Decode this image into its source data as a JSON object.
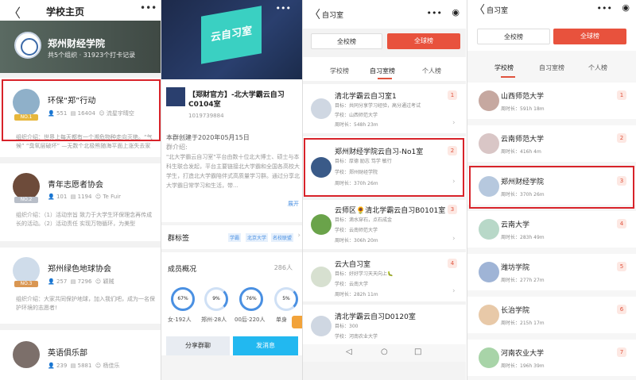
{
  "p1": {
    "back": "〈",
    "title": "学校主页",
    "dots": "•••",
    "school_name": "郑州财经学院",
    "school_sub": "共5个组织 · 31923个打卡记录",
    "cards": [
      {
        "name": "环保“郑”行动",
        "badge": "NO.1",
        "s1": "551",
        "s2": "16404",
        "s3": "流星宇晴空",
        "desc": "组织介绍：世界上每天都有一个濒危物种走向灭绝。“气候” “臭氧层破坏” —无数个北极熊随海平面上涨失去家"
      },
      {
        "name": "青年志愿者协会",
        "badge": "NO.2",
        "s1": "101",
        "s2": "1194",
        "s3": "Te Fuir",
        "desc": "组织介绍：（1）活动宗旨 致力于大学生环保理念再传成长的活动。（2）活动责任 实现万物循环，为美型"
      },
      {
        "name": "郑州绿色地球协会",
        "badge": "NO.3",
        "s1": "257",
        "s2": "7296",
        "s3": "颖贼",
        "desc": "组织介绍：大家共同保护地球，加入我们吧，成为一名保护环境的志愿者!"
      },
      {
        "name": "英语俱乐部",
        "badge": "",
        "s1": "239",
        "s2": "5881",
        "s3": "杨佳乐",
        "desc": ""
      }
    ]
  },
  "p2": {
    "dots": "•••",
    "cloud": "云自习室",
    "group_title": "【郑财官方】-北大学霸云自习C0104室",
    "group_id": "1019739884",
    "create_date": "本群创建于2020年05月15日",
    "intro_label": "群介绍:",
    "intro": "\"北大学霸云自习室\"平台由数十位北大博士、硕士与本科生联合发起，平台主要链接北大学霸和全国各高校大学生，打造北大学霸陪伴式高质量学习群。通过分享北大学霸日常学习和生活，带...",
    "expand": "展开",
    "tags_label": "群标签",
    "tags": [
      "学霸",
      "北京大学",
      "名校联盟"
    ],
    "members_label": "成员概况",
    "members_count": "286人",
    "rings": [
      {
        "pct": "67%",
        "label": "女·192人"
      },
      {
        "pct": "9%",
        "label": "郑州·28人"
      },
      {
        "pct": "76%",
        "label": "00后·220人"
      },
      {
        "pct": "5%",
        "label": "单身"
      }
    ],
    "share_btn": "分享群聊",
    "send_btn": "发消息"
  },
  "p3": {
    "back": "〈",
    "title": "自习室",
    "dots": "•••",
    "target": "◉",
    "btn_school": "全校榜",
    "btn_global": "全球榜",
    "tabs": [
      "学校榜",
      "自习室榜",
      "个人榜"
    ],
    "rows": [
      {
        "name": "清北学霸云自习室1",
        "goal": "目标：共同分享学习经验，高分通过考试",
        "school": "学校：山西师范大学",
        "time": "周时长：548h 23m",
        "rank": "1"
      },
      {
        "name": "郑州财经学院云自习-No1室",
        "goal": "目标：厚德 励志 笃学 敏行",
        "school": "学校：郑州财经学院",
        "time": "周时长：370h 26m",
        "rank": "2"
      },
      {
        "name": "云师区🌻清北学霸云自习B0101室",
        "goal": "目标：滴水穿石，点石成金",
        "school": "学校：云南师范大学",
        "time": "周时长：306h 20m",
        "rank": "3"
      },
      {
        "name": "云大自习室",
        "goal": "目标：好好学习天天向上🐛",
        "school": "学校：云南大学",
        "time": "周时长：282h 11m",
        "rank": "4"
      },
      {
        "name": "清北学霸云自习D0120室",
        "goal": "目标：300",
        "school": "学校：河南农业大学",
        "time": "",
        "rank": ""
      }
    ]
  },
  "p4": {
    "back": "〈",
    "title": "自习室",
    "dots": "•••",
    "target": "◉",
    "btn_school": "全校榜",
    "btn_global": "全球榜",
    "tabs": [
      "学校榜",
      "自习室榜",
      "个人榜"
    ],
    "rows": [
      {
        "name": "山西师范大学",
        "time": "周时长：591h 18m",
        "rank": "1"
      },
      {
        "name": "云南师范大学",
        "time": "周时长：416h 4m",
        "rank": "2"
      },
      {
        "name": "郑州财经学院",
        "time": "周时长：370h 26m",
        "rank": "3"
      },
      {
        "name": "云南大学",
        "time": "周时长：283h 49m",
        "rank": "4"
      },
      {
        "name": "潍坊学院",
        "time": "周时长：277h 27m",
        "rank": "5"
      },
      {
        "name": "长治学院",
        "time": "周时长：215h 17m",
        "rank": "6"
      },
      {
        "name": "河南农业大学",
        "time": "周时长：196h 39m",
        "rank": "7"
      }
    ]
  },
  "colors": {
    "accent": "#e8523d",
    "highlight_box": "#d8232a",
    "blue": "#22b8f0"
  }
}
